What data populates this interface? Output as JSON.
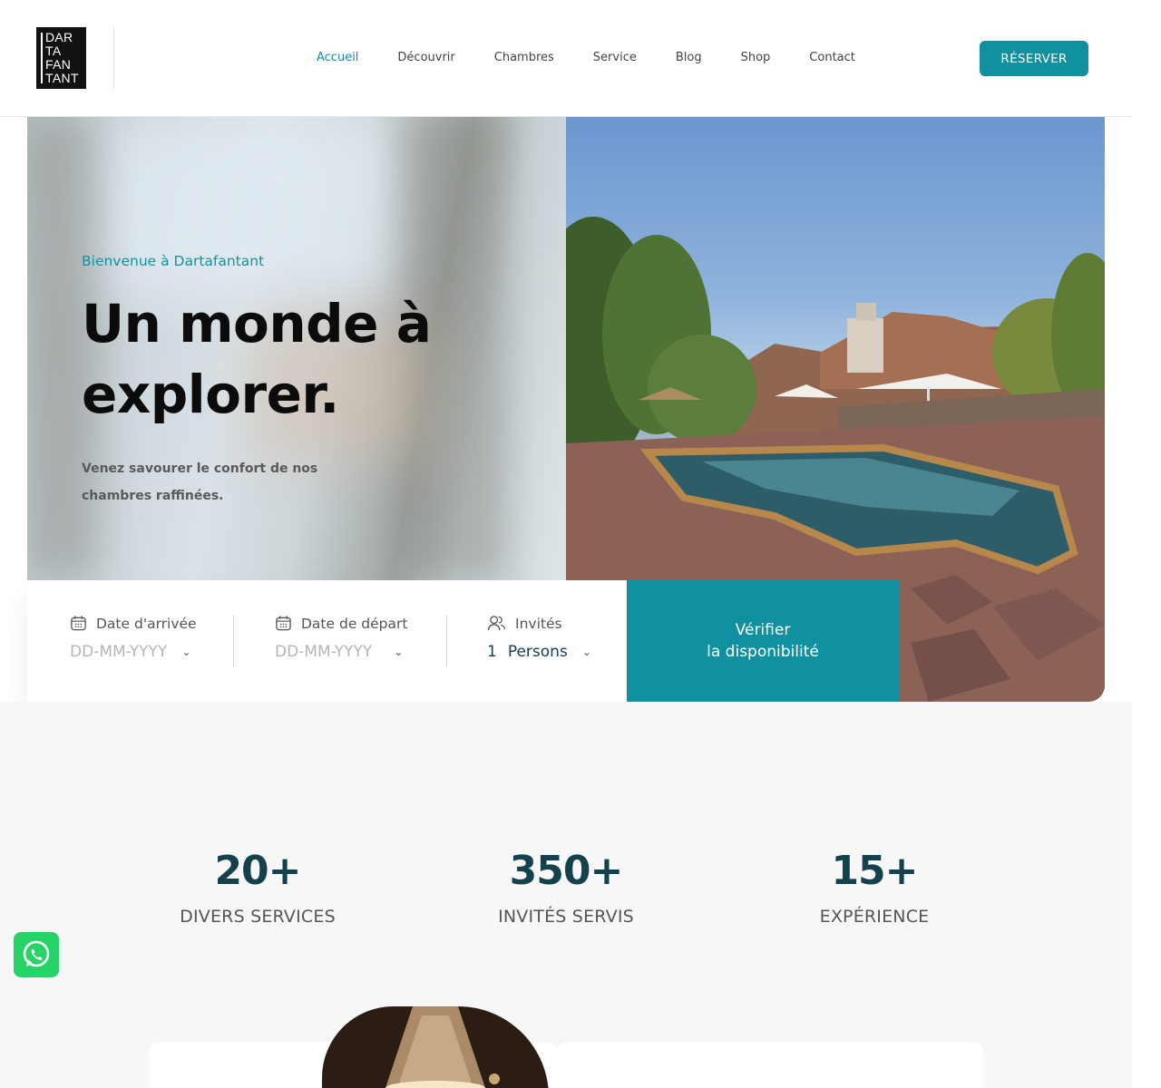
{
  "header": {
    "logo_lines": [
      "DAR",
      "TA",
      "FAN",
      "TANT"
    ],
    "nav": [
      "Accueil",
      "Découvrir",
      "Chambres",
      "Service",
      "Blog",
      "Shop",
      "Contact"
    ],
    "active_nav": "Accueil",
    "reserve_label": "RÉSERVER"
  },
  "hero": {
    "kicker": "Bienvenue à Dartafantant",
    "headline_line1": "Un monde à",
    "headline_line2": "explorer.",
    "subtext": "Venez savourer le confort de nos chambres raffinées."
  },
  "booking": {
    "arrival_label": "Date d'arrivée",
    "arrival_value": "DD-MM-YYYY",
    "departure_label": "Date de départ",
    "departure_value": "DD-MM-YYYY",
    "guests_label": "Invités",
    "guests_count": "1",
    "guests_unit": "Persons",
    "check_line1": "Vérifier",
    "check_line2": "la disponibilité"
  },
  "stats": [
    {
      "number": "20+",
      "label": "DIVERS SERVICES"
    },
    {
      "number": "350+",
      "label": "INVITÉS SERVIS"
    },
    {
      "number": "15+",
      "label": "EXPÉRIENCE"
    }
  ],
  "colors": {
    "accent": "#11919f",
    "heading_dark": "#15414d"
  },
  "icons": {
    "calendar": "calendar-icon",
    "guests": "users-icon",
    "chevron": "chevron-down-icon",
    "whatsapp": "whatsapp-icon"
  }
}
